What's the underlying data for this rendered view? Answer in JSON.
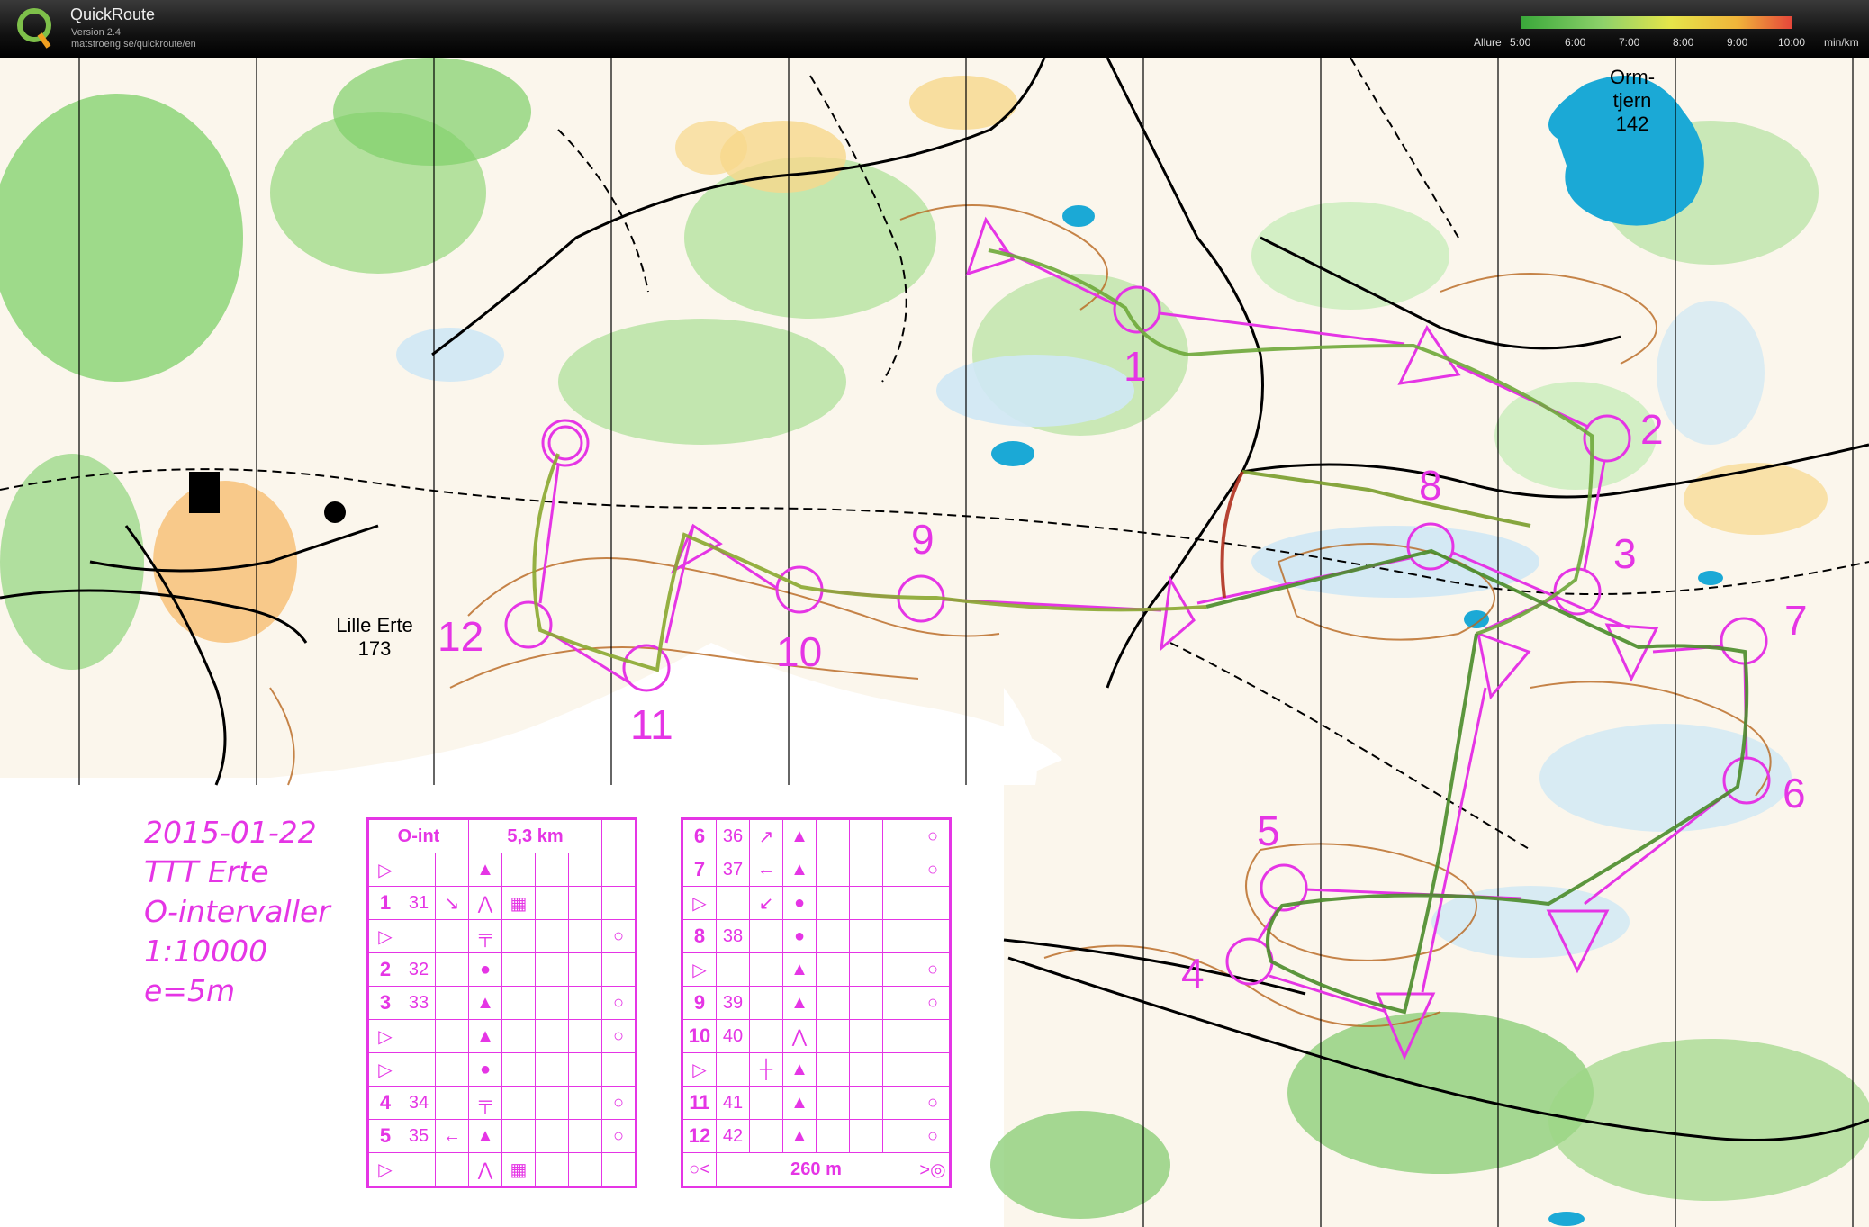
{
  "app": {
    "title": "QuickRoute",
    "version": "Version 2.4",
    "url": "matstroeng.se/quickroute/en"
  },
  "pace_legend": {
    "label": "Allure",
    "ticks": [
      "5:00",
      "6:00",
      "7:00",
      "8:00",
      "9:00",
      "10:00"
    ],
    "unit": "min/km",
    "colors": [
      "#3aa83a",
      "#8dd16a",
      "#e5e54a",
      "#f0b43a",
      "#e5473a"
    ]
  },
  "map": {
    "lake_name": "Orm-\ntjern\n142",
    "hill_name": "Lille Erte\n173",
    "course_color": "#e535e5",
    "controls": [
      "1",
      "2",
      "3",
      "4",
      "5",
      "6",
      "7",
      "8",
      "9",
      "10",
      "11",
      "12"
    ]
  },
  "meta": {
    "date": "2015-01-22",
    "event": "TTT Erte",
    "type": "O-intervaller",
    "scale": "1:10000",
    "contour": "e=5m"
  },
  "control_descriptions": {
    "header": {
      "course": "O-int",
      "length": "5,3 km"
    },
    "left_rows": [
      {
        "num": "",
        "code": "",
        "symbol": "▷"
      },
      {
        "num": "1",
        "code": "31"
      },
      {
        "num": "",
        "code": "",
        "symbol": "▷"
      },
      {
        "num": "2",
        "code": "32"
      },
      {
        "num": "3",
        "code": "33"
      },
      {
        "num": "",
        "code": "",
        "symbol": "▷"
      },
      {
        "num": "",
        "code": "",
        "symbol": "▷"
      },
      {
        "num": "4",
        "code": "34"
      },
      {
        "num": "5",
        "code": "35"
      },
      {
        "num": "",
        "code": "",
        "symbol": "▷"
      }
    ],
    "right_rows": [
      {
        "num": "6",
        "code": "36"
      },
      {
        "num": "7",
        "code": "37"
      },
      {
        "num": "",
        "code": "",
        "symbol": "▷"
      },
      {
        "num": "8",
        "code": "38"
      },
      {
        "num": "",
        "code": "",
        "symbol": "▷"
      },
      {
        "num": "9",
        "code": "39"
      },
      {
        "num": "10",
        "code": "40"
      },
      {
        "num": "",
        "code": "",
        "symbol": "▷"
      },
      {
        "num": "11",
        "code": "41"
      },
      {
        "num": "12",
        "code": "42"
      }
    ],
    "finish_distance": "260 m"
  }
}
